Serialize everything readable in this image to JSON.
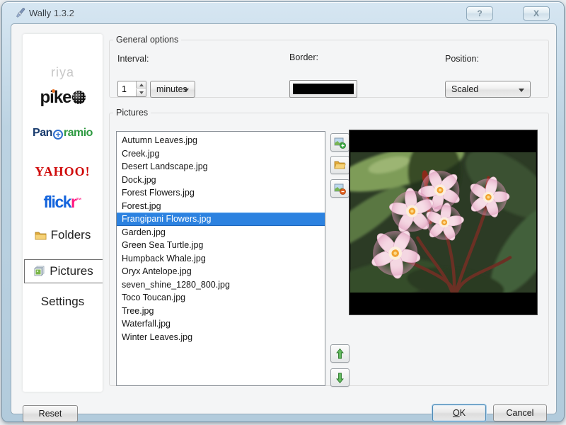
{
  "window": {
    "title": "Wally 1.3.2",
    "help": "?",
    "close": "X"
  },
  "sidebar": {
    "riya": "riya",
    "pikeo": {
      "text": "pike"
    },
    "panoramio": {
      "pan": "Pan",
      "plus": "+",
      "ramio": "ramio"
    },
    "yahoo": "YAHOO!",
    "flickr": {
      "flick": "flick",
      "r": "r",
      "tm": "™"
    },
    "folders": "Folders",
    "pictures": "Pictures",
    "settings": "Settings"
  },
  "general": {
    "group_label": "General options",
    "interval_label": "Interval:",
    "interval_value": "1",
    "interval_unit": "minutes",
    "border_label": "Border:",
    "border_color": "#000000",
    "position_label": "Position:",
    "position_value": "Scaled"
  },
  "pictures": {
    "group_label": "Pictures",
    "selected_index": 6,
    "files": [
      "Autumn Leaves.jpg",
      "Creek.jpg",
      "Desert Landscape.jpg",
      "Dock.jpg",
      "Forest Flowers.jpg",
      "Forest.jpg",
      "Frangipani Flowers.jpg",
      "Garden.jpg",
      "Green Sea Turtle.jpg",
      "Humpback Whale.jpg",
      "Oryx Antelope.jpg",
      "seven_shine_1280_800.jpg",
      "Toco Toucan.jpg",
      "Tree.jpg",
      "Waterfall.jpg",
      "Winter Leaves.jpg"
    ]
  },
  "footer": {
    "reset": "Reset",
    "ok_mnemonic": "O",
    "ok_rest": "K",
    "cancel": "Cancel"
  },
  "colors": {
    "selection": "#2c82e0",
    "titlebar_gradient_top": "#d6e6f2",
    "border_swatch": "#000000"
  }
}
